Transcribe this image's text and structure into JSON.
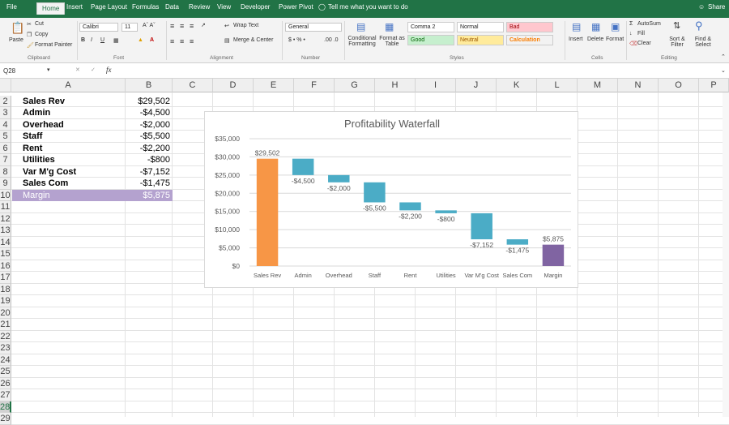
{
  "menu": {
    "file": "File",
    "tabs": [
      "Home",
      "Insert",
      "Page Layout",
      "Formulas",
      "Data",
      "Review",
      "View",
      "Developer",
      "Power Pivot"
    ],
    "tell_me": "Tell me what you want to do",
    "share": "Share"
  },
  "ribbon": {
    "clipboard": {
      "paste": "Paste",
      "cut": "Cut",
      "copy": "Copy",
      "format_painter": "Format Painter",
      "group": "Clipboard"
    },
    "font": {
      "name": "Calibri",
      "size": "11",
      "group": "Font"
    },
    "alignment": {
      "wrap": "Wrap Text",
      "merge": "Merge & Center",
      "group": "Alignment"
    },
    "number": {
      "format": "General",
      "group": "Number"
    },
    "styles": {
      "conditional": "Conditional Formatting",
      "format_table": "Format as Table",
      "cells": [
        "Comma 2",
        "Normal",
        "Bad",
        "Good",
        "Neutral",
        "Calculation"
      ],
      "group": "Styles"
    },
    "cells": {
      "insert": "Insert",
      "delete": "Delete",
      "format": "Format",
      "group": "Cells"
    },
    "editing": {
      "autosum": "AutoSum",
      "fill": "Fill",
      "clear": "Clear",
      "sort": "Sort & Filter",
      "find": "Find & Select",
      "group": "Editing"
    }
  },
  "formula_bar": {
    "name_box": "Q28",
    "fx": "fx",
    "value": ""
  },
  "columns": [
    "A",
    "B",
    "C",
    "D",
    "E",
    "F",
    "G",
    "H",
    "I",
    "J",
    "K",
    "L",
    "M",
    "N",
    "O",
    "P"
  ],
  "rows": [
    1,
    2,
    3,
    4,
    5,
    6,
    7,
    8,
    9,
    10,
    11,
    12,
    13,
    14,
    15,
    16,
    17,
    18,
    19,
    20,
    21,
    22,
    23,
    24,
    25,
    26,
    27,
    28,
    29
  ],
  "cells": [
    {
      "label": "Sales Rev",
      "value": "$29,502"
    },
    {
      "label": "Admin",
      "value": "-$4,500"
    },
    {
      "label": "Overhead",
      "value": "-$2,000"
    },
    {
      "label": "Staff",
      "value": "-$5,500"
    },
    {
      "label": "Rent",
      "value": "-$2,200"
    },
    {
      "label": "Utilities",
      "value": "-$800"
    },
    {
      "label": "Var M'g Cost",
      "value": "-$7,152"
    },
    {
      "label": "Sales Com",
      "value": "-$1,475"
    },
    {
      "label": "Margin",
      "value": "$5,875"
    }
  ],
  "chart_data": {
    "type": "bar",
    "subtype": "waterfall",
    "title": "Profitability Waterfall",
    "categories": [
      "Sales Rev",
      "Admin",
      "Overhead",
      "Staff",
      "Rent",
      "Utilities",
      "Var M'g Cost",
      "Sales Com",
      "Margin"
    ],
    "values": [
      29502,
      -4500,
      -2000,
      -5500,
      -2200,
      -800,
      -7152,
      -1475,
      5875
    ],
    "data_labels": [
      "$29,502",
      "-$4,500",
      "-$2,000",
      "-$5,500",
      "-$2,200",
      "-$800",
      "-$7,152",
      "-$1,475",
      "$5,875"
    ],
    "yticks": [
      "$0",
      "$5,000",
      "$10,000",
      "$15,000",
      "$20,000",
      "$25,000",
      "$30,000",
      "$35,000"
    ],
    "ylim": [
      0,
      35000
    ],
    "grid": true,
    "colors": {
      "start": "#f79646",
      "delta": "#4bacc6",
      "total": "#8064a2"
    }
  }
}
